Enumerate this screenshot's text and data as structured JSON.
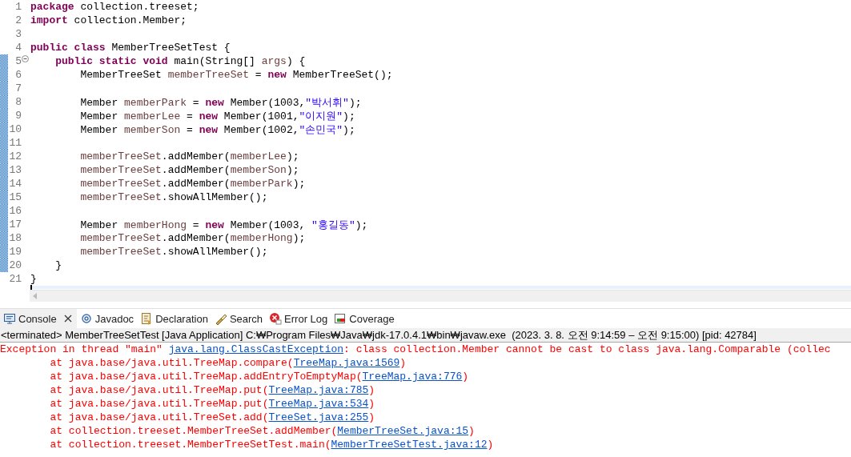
{
  "editor": {
    "lines": [
      {
        "number": "1",
        "changed": false,
        "tokens": [
          {
            "kind": "keyword",
            "text": "package"
          },
          {
            "kind": "plain",
            "text": " collection.treeset;"
          }
        ]
      },
      {
        "number": "2",
        "changed": false,
        "tokens": [
          {
            "kind": "keyword",
            "text": "import"
          },
          {
            "kind": "plain",
            "text": " collection.Member;"
          }
        ]
      },
      {
        "number": "3",
        "changed": false
      },
      {
        "number": "4",
        "changed": false,
        "tokens": [
          {
            "kind": "keyword",
            "text": "public class"
          },
          {
            "kind": "plain",
            "text": " MemberTreeSetTest {"
          }
        ]
      },
      {
        "number": "5",
        "changed": true,
        "kind": "foldable",
        "tokens": [
          {
            "kind": "keyword",
            "text": "    public static void"
          },
          {
            "kind": "plain",
            "text": " main(String[] "
          },
          {
            "kind": "variable",
            "text": "args"
          },
          {
            "kind": "plain",
            "text": ") {"
          }
        ]
      },
      {
        "number": "6",
        "changed": true,
        "tokens": [
          {
            "kind": "plain",
            "text": "        MemberTreeSet "
          },
          {
            "kind": "variable",
            "text": "memberTreeSet"
          },
          {
            "kind": "plain",
            "text": " = "
          },
          {
            "kind": "keyword",
            "text": "new"
          },
          {
            "kind": "plain",
            "text": " MemberTreeSet();"
          }
        ]
      },
      {
        "number": "7",
        "changed": true
      },
      {
        "number": "8",
        "changed": true,
        "tokens": [
          {
            "kind": "plain",
            "text": "        Member "
          },
          {
            "kind": "variable",
            "text": "memberPark"
          },
          {
            "kind": "plain",
            "text": " = "
          },
          {
            "kind": "keyword",
            "text": "new"
          },
          {
            "kind": "plain",
            "text": " Member(1003,"
          },
          {
            "kind": "string",
            "text": "\"박서휘\""
          },
          {
            "kind": "plain",
            "text": ");"
          }
        ]
      },
      {
        "number": "9",
        "changed": true,
        "tokens": [
          {
            "kind": "plain",
            "text": "        Member "
          },
          {
            "kind": "variable",
            "text": "memberLee"
          },
          {
            "kind": "plain",
            "text": " = "
          },
          {
            "kind": "keyword",
            "text": "new"
          },
          {
            "kind": "plain",
            "text": " Member(1001,"
          },
          {
            "kind": "string",
            "text": "\"이지원\""
          },
          {
            "kind": "plain",
            "text": ");"
          }
        ]
      },
      {
        "number": "10",
        "changed": true,
        "tokens": [
          {
            "kind": "plain",
            "text": "        Member "
          },
          {
            "kind": "variable",
            "text": "memberSon"
          },
          {
            "kind": "plain",
            "text": " = "
          },
          {
            "kind": "keyword",
            "text": "new"
          },
          {
            "kind": "plain",
            "text": " Member(1002,"
          },
          {
            "kind": "string",
            "text": "\"손민국\""
          },
          {
            "kind": "plain",
            "text": ");"
          }
        ]
      },
      {
        "number": "11",
        "changed": true
      },
      {
        "number": "12",
        "changed": true,
        "tokens": [
          {
            "kind": "variable",
            "text": "        memberTreeSet"
          },
          {
            "kind": "plain",
            "text": ".addMember("
          },
          {
            "kind": "variable",
            "text": "memberLee"
          },
          {
            "kind": "plain",
            "text": ");"
          }
        ]
      },
      {
        "number": "13",
        "changed": true,
        "tokens": [
          {
            "kind": "variable",
            "text": "        memberTreeSet"
          },
          {
            "kind": "plain",
            "text": ".addMember("
          },
          {
            "kind": "variable",
            "text": "memberSon"
          },
          {
            "kind": "plain",
            "text": ");"
          }
        ]
      },
      {
        "number": "14",
        "changed": true,
        "tokens": [
          {
            "kind": "variable",
            "text": "        memberTreeSet"
          },
          {
            "kind": "plain",
            "text": ".addMember("
          },
          {
            "kind": "variable",
            "text": "memberPark"
          },
          {
            "kind": "plain",
            "text": ");"
          }
        ]
      },
      {
        "number": "15",
        "changed": true,
        "tokens": [
          {
            "kind": "variable",
            "text": "        memberTreeSet"
          },
          {
            "kind": "plain",
            "text": ".showAllMember();"
          }
        ]
      },
      {
        "number": "16",
        "changed": true
      },
      {
        "number": "17",
        "changed": true,
        "tokens": [
          {
            "kind": "plain",
            "text": "        Member "
          },
          {
            "kind": "variable",
            "text": "memberHong"
          },
          {
            "kind": "plain",
            "text": " = "
          },
          {
            "kind": "keyword",
            "text": "new"
          },
          {
            "kind": "plain",
            "text": " Member(1003, "
          },
          {
            "kind": "string",
            "text": "\"홍길동\""
          },
          {
            "kind": "plain",
            "text": ");"
          }
        ]
      },
      {
        "number": "18",
        "changed": true,
        "tokens": [
          {
            "kind": "variable",
            "text": "        memberTreeSet"
          },
          {
            "kind": "plain",
            "text": ".addMember("
          },
          {
            "kind": "variable",
            "text": "memberHong"
          },
          {
            "kind": "plain",
            "text": ");"
          }
        ]
      },
      {
        "number": "19",
        "changed": true,
        "tokens": [
          {
            "kind": "variable",
            "text": "        memberTreeSet"
          },
          {
            "kind": "plain",
            "text": ".showAllMember();"
          }
        ]
      },
      {
        "number": "20",
        "changed": true,
        "tokens": [
          {
            "kind": "plain",
            "text": "    }"
          }
        ]
      },
      {
        "number": "21",
        "changed": false,
        "tokens": [
          {
            "kind": "plain",
            "text": "}"
          }
        ]
      }
    ]
  },
  "console": {
    "tabs": [
      {
        "label": "Console",
        "selected": true,
        "closable": true
      },
      {
        "label": "Javadoc",
        "selected": false,
        "closable": false
      },
      {
        "label": "Declaration",
        "selected": false,
        "closable": false
      },
      {
        "label": "Search",
        "selected": false,
        "closable": false
      },
      {
        "label": "Error Log",
        "selected": false,
        "closable": false
      },
      {
        "label": "Coverage",
        "selected": false,
        "closable": false
      }
    ],
    "status": "<terminated> MemberTreeSetTest [Java Application] C:₩Program Files₩Java₩jdk-17.0.4.1₩bin₩javaw.exe  (2023. 3. 8. 오전 9:14:59 – 오전 9:15:00) [pid: 42784]",
    "output": [
      [
        {
          "kind": "error",
          "text": "Exception in thread \"main\" "
        },
        {
          "kind": "link",
          "text": "java.lang.ClassCastException"
        },
        {
          "kind": "error",
          "text": ": class collection.Member cannot be cast to class java.lang.Comparable (collec"
        }
      ],
      [
        {
          "kind": "error",
          "text": "\tat java.base/java.util.TreeMap.compare("
        },
        {
          "kind": "link",
          "text": "TreeMap.java:1569"
        },
        {
          "kind": "error",
          "text": ")"
        }
      ],
      [
        {
          "kind": "error",
          "text": "\tat java.base/java.util.TreeMap.addEntryToEmptyMap("
        },
        {
          "kind": "link",
          "text": "TreeMap.java:776"
        },
        {
          "kind": "error",
          "text": ")"
        }
      ],
      [
        {
          "kind": "error",
          "text": "\tat java.base/java.util.TreeMap.put("
        },
        {
          "kind": "link",
          "text": "TreeMap.java:785"
        },
        {
          "kind": "error",
          "text": ")"
        }
      ],
      [
        {
          "kind": "error",
          "text": "\tat java.base/java.util.TreeMap.put("
        },
        {
          "kind": "link",
          "text": "TreeMap.java:534"
        },
        {
          "kind": "error",
          "text": ")"
        }
      ],
      [
        {
          "kind": "error",
          "text": "\tat java.base/java.util.TreeSet.add("
        },
        {
          "kind": "link",
          "text": "TreeSet.java:255"
        },
        {
          "kind": "error",
          "text": ")"
        }
      ],
      [
        {
          "kind": "error",
          "text": "\tat collection.treeset.MemberTreeSet.addMember("
        },
        {
          "kind": "link",
          "text": "MemberTreeSet.java:15"
        },
        {
          "kind": "error",
          "text": ")"
        }
      ],
      [
        {
          "kind": "error",
          "text": "\tat collection.treeset.MemberTreeSetTest.main("
        },
        {
          "kind": "link",
          "text": "MemberTreeSetTest.java:12"
        },
        {
          "kind": "error",
          "text": ")"
        }
      ]
    ]
  }
}
